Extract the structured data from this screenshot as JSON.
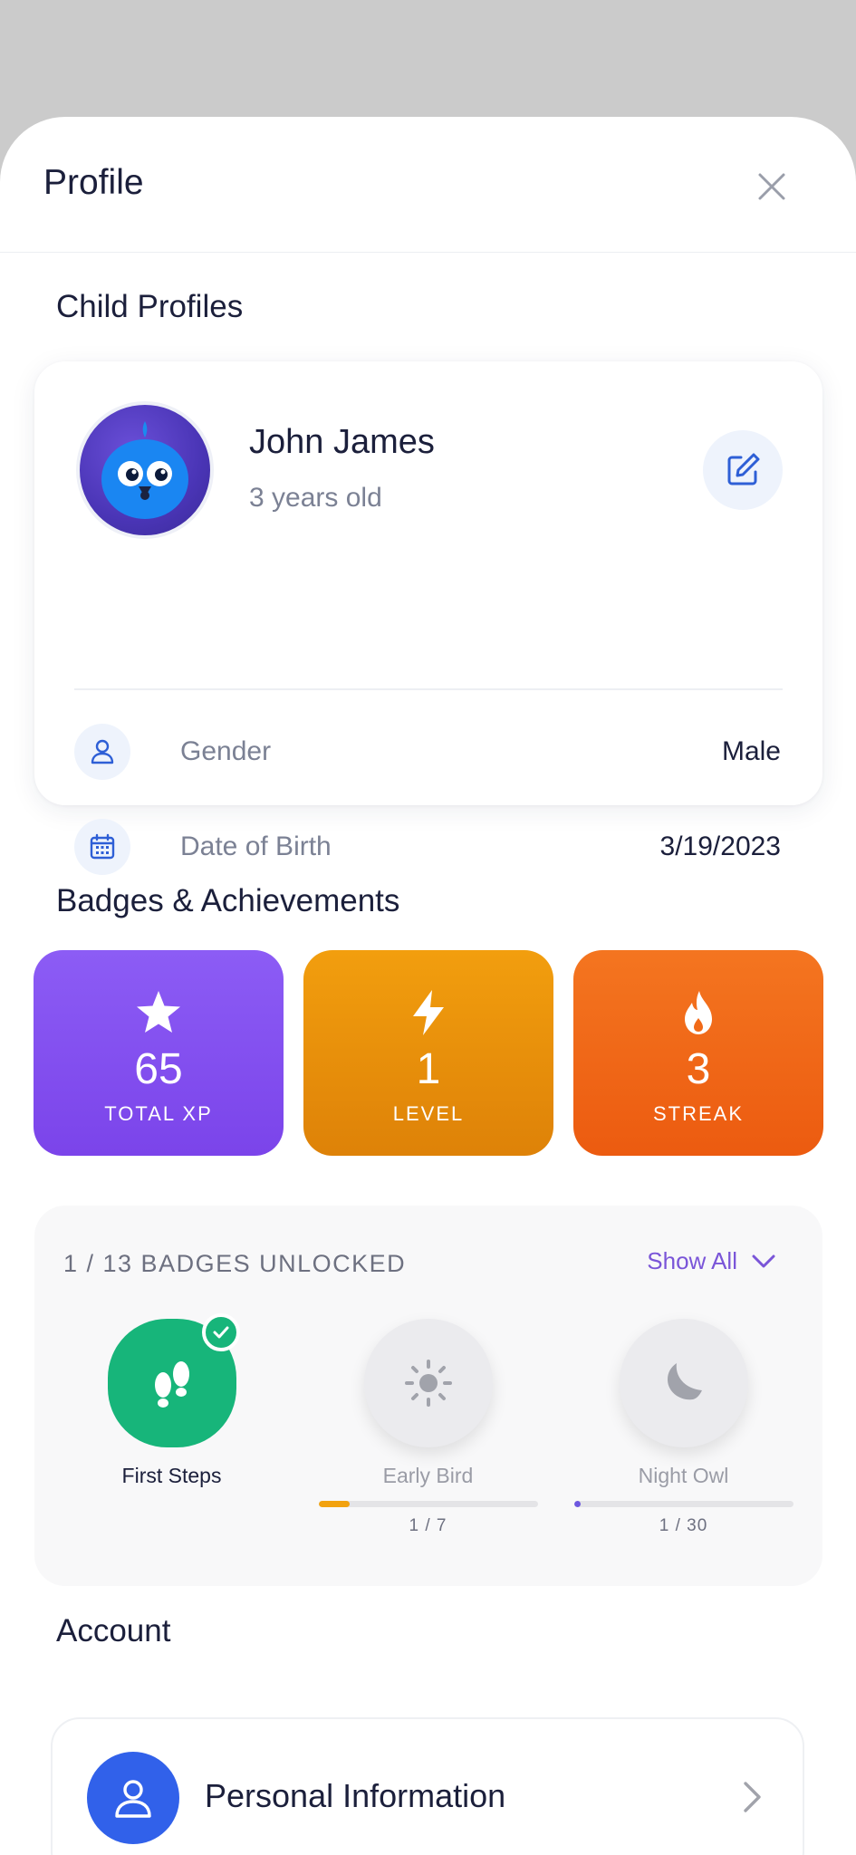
{
  "header": {
    "title": "Profile"
  },
  "child_profiles": {
    "section_title": "Child Profiles",
    "name": "John James",
    "age": "3 years old",
    "gender_label": "Gender",
    "gender_value": "Male",
    "dob_label": "Date of Birth",
    "dob_value": "3/19/2023"
  },
  "badges_section": {
    "title": "Badges & Achievements",
    "stats": {
      "xp": {
        "value": "65",
        "label": "TOTAL XP",
        "icon": "star-icon"
      },
      "level": {
        "value": "1",
        "label": "LEVEL",
        "icon": "lightning-icon"
      },
      "streak": {
        "value": "3",
        "label": "STREAK",
        "icon": "flame-icon"
      }
    },
    "unlocked_text": "1 / 13 BADGES UNLOCKED",
    "show_all_label": "Show All",
    "badges": [
      {
        "name": "First Steps",
        "unlocked": true,
        "icon": "footsteps-icon"
      },
      {
        "name": "Early Bird",
        "unlocked": false,
        "progress_text": "1 / 7",
        "progress": 0.143,
        "color": "#f2a20f",
        "icon": "sun-icon"
      },
      {
        "name": "Night Owl",
        "unlocked": false,
        "progress_text": "1 / 30",
        "progress": 0.033,
        "color": "#6d58e0",
        "icon": "moon-icon"
      }
    ]
  },
  "account": {
    "section_title": "Account",
    "items": [
      {
        "label": "Personal Information",
        "icon": "user-icon"
      }
    ]
  }
}
